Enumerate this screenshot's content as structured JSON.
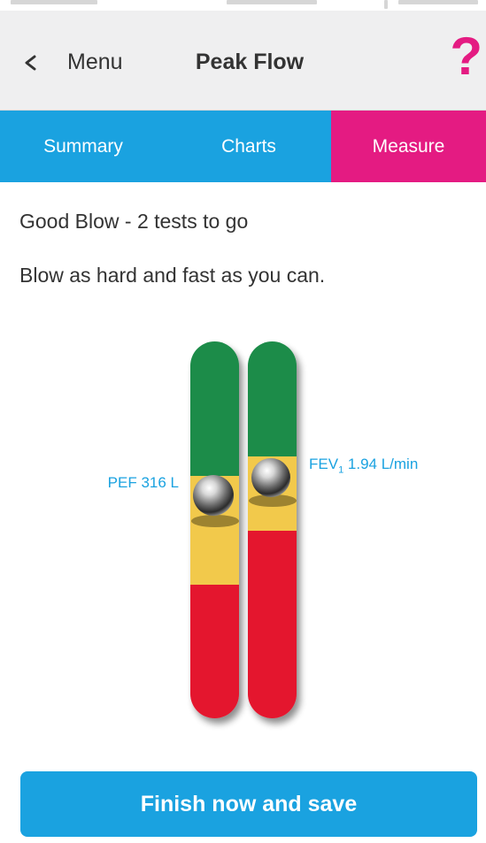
{
  "nav": {
    "back_label": "Menu",
    "title": "Peak Flow",
    "help_label": "?"
  },
  "tabs": [
    {
      "label": "Summary",
      "active": false
    },
    {
      "label": "Charts",
      "active": false
    },
    {
      "label": "Measure",
      "active": true
    }
  ],
  "measure": {
    "status": "Good Blow - 2 tests to go",
    "instruction": "Blow as hard and fast as you can.",
    "gauges": [
      {
        "name": "pef",
        "label": "PEF 316 L"
      },
      {
        "name": "fev",
        "label_main": "FEV",
        "label_sub": "1",
        "label_rest": " 1.94 L/min"
      }
    ]
  },
  "finish_button": {
    "label": "Finish now and save"
  },
  "colors": {
    "accent_blue": "#1aa2e0",
    "accent_pink": "#e41b82",
    "zone_green": "#1c8c48",
    "zone_yellow": "#f2c94c",
    "zone_red": "#e4182e"
  }
}
